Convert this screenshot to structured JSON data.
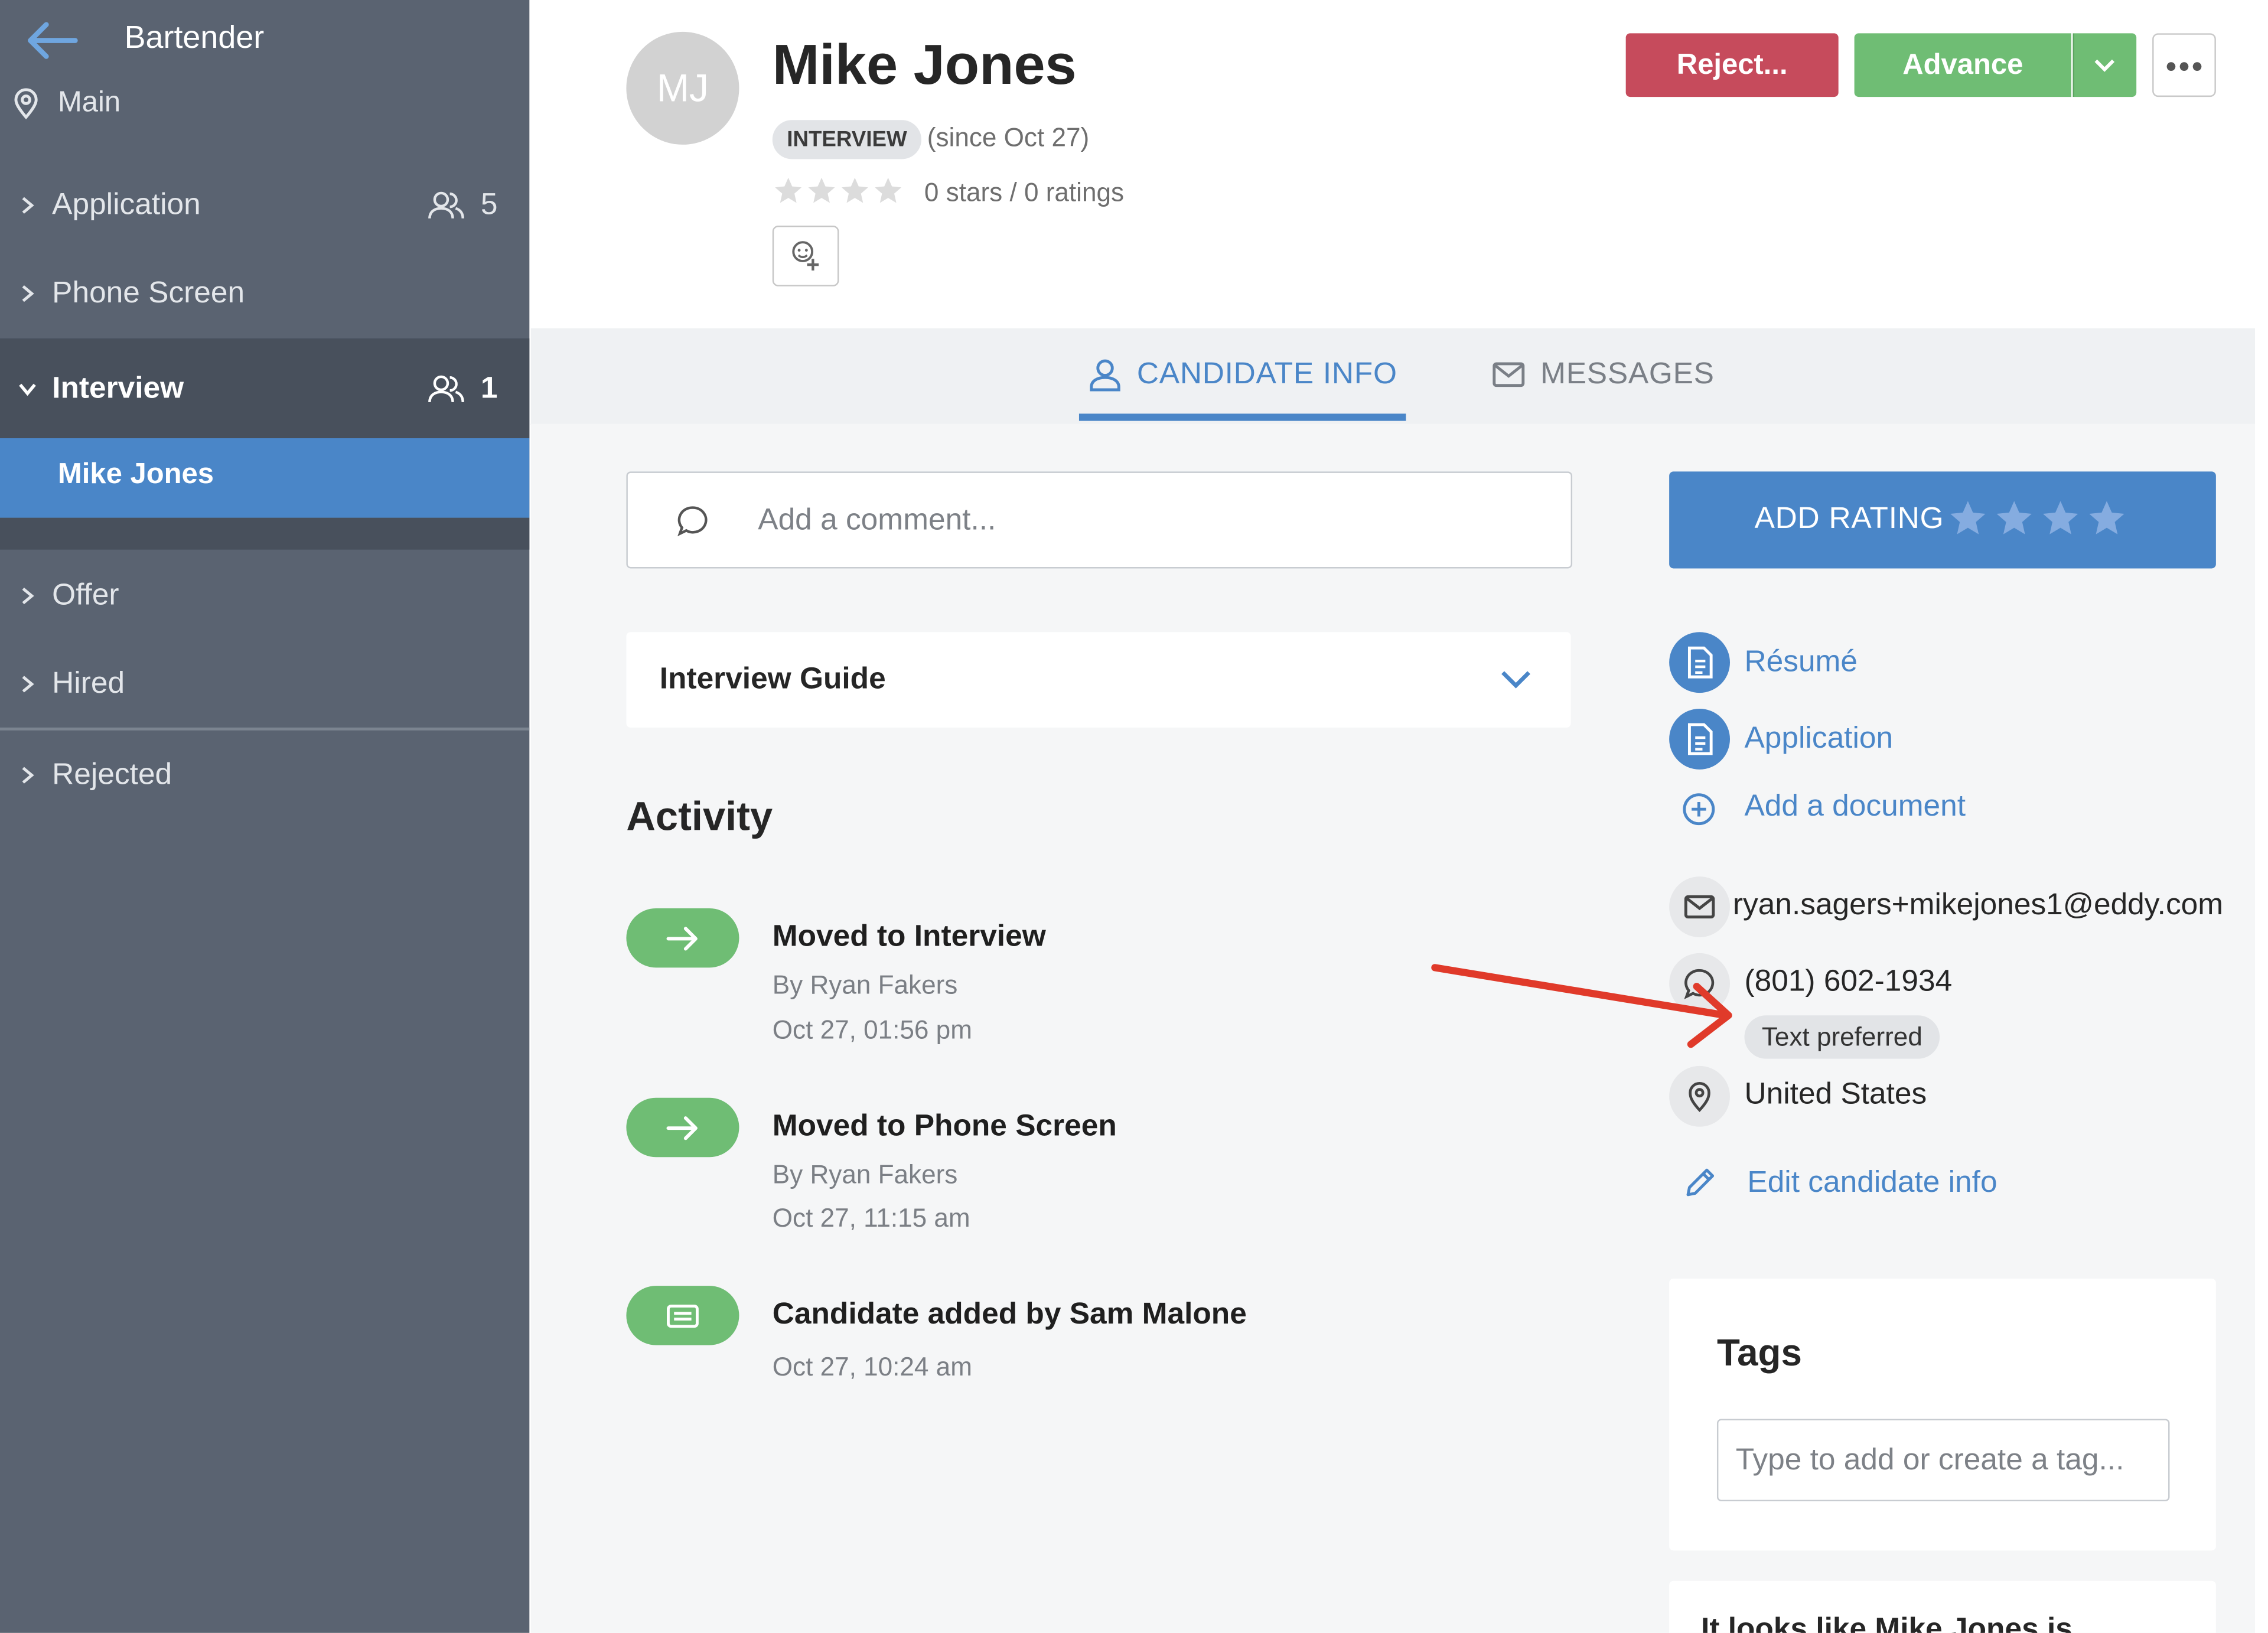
{
  "sidebar": {
    "job_title": "Bartender",
    "location": "Main",
    "stages": [
      {
        "label": "Application",
        "count": "5"
      },
      {
        "label": "Phone Screen",
        "count": ""
      },
      {
        "label": "Interview",
        "count": "1"
      },
      {
        "label": "Offer",
        "count": ""
      },
      {
        "label": "Hired",
        "count": ""
      },
      {
        "label": "Rejected",
        "count": ""
      }
    ],
    "active_candidate": "Mike Jones"
  },
  "header": {
    "initials": "MJ",
    "name": "Mike Jones",
    "stage_badge": "INTERVIEW",
    "since": "(since Oct 27)",
    "rating_text": "0 stars / 0 ratings",
    "reject_label": "Reject...",
    "advance_label": "Advance"
  },
  "tabs": {
    "candidate_info": "CANDIDATE INFO",
    "messages": "MESSAGES"
  },
  "comment": {
    "placeholder": "Add a comment..."
  },
  "guide": {
    "label": "Interview Guide"
  },
  "activity": {
    "title": "Activity",
    "items": [
      {
        "title": "Moved to Interview",
        "by": "By Ryan Fakers",
        "date": "Oct 27, 01:56 pm"
      },
      {
        "title": "Moved to Phone Screen",
        "by": "By Ryan Fakers",
        "date": "Oct 27, 11:15 am"
      },
      {
        "title": "Candidate added by Sam Malone",
        "date": "Oct 27, 10:24 am"
      }
    ]
  },
  "right": {
    "add_rating": "ADD RATING",
    "documents": [
      "Résumé",
      "Application"
    ],
    "add_document": "Add a document",
    "email": "ryan.sagers+mikejones1@eddy.com",
    "phone": "(801) 602-1934",
    "phone_badge": "Text preferred",
    "country": "United States",
    "edit_link": "Edit candidate info"
  },
  "tags": {
    "title": "Tags",
    "placeholder": "Type to add or create a tag..."
  },
  "notice": {
    "text": "It looks like Mike Jones is"
  },
  "colors": {
    "sidebar": "#5a6371",
    "accent": "#4a86c8",
    "reject": "#c64b5c",
    "advance": "#6fbd74",
    "annotation_arrow": "#e03a2a"
  }
}
